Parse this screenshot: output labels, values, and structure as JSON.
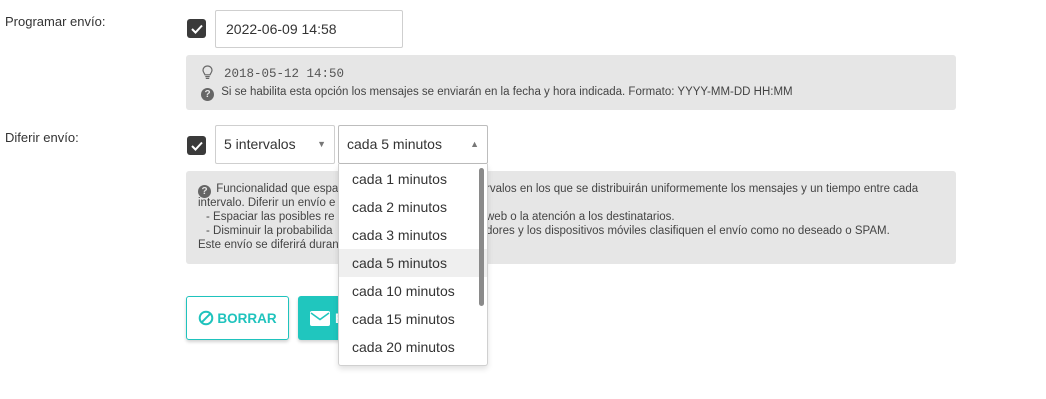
{
  "schedule": {
    "label": "Programar envío:",
    "checked": true,
    "datetime_value": "2022-06-09 14:58",
    "hint_example": "2018-05-12 14:50",
    "help_text": "Si se habilita esta opción los mensajes se enviarán en la fecha y hora indicada. Formato: YYYY-MM-DD HH:MM"
  },
  "defer": {
    "label": "Diferir envío:",
    "checked": true,
    "intervals_value": "5 intervalos",
    "interval_select_value": "cada 5 minutos",
    "help_line1_left": "Funcionalidad que espa",
    "help_line1_right": "rvalos en los que se distribuirán uniformemente los mensajes y un tiempo entre cada",
    "help_line2": "intervalo. Diferir un envío e",
    "help_line3_left": "- Espaciar las posibles re",
    "help_line3_right": "web o la atención a los destinatarios.",
    "help_line4_left": "- Disminuir la probabilida",
    "help_line4_right": "dores y los dispositivos móviles clasifiquen el envío como no deseado o SPAM.",
    "help_line5": "Este envío se diferirá duran"
  },
  "dropdown": {
    "options": [
      "cada 1 minutos",
      "cada 2 minutos",
      "cada 3 minutos",
      "cada 5 minutos",
      "cada 10 minutos",
      "cada 15 minutos",
      "cada 20 minutos"
    ],
    "selected_index": 3
  },
  "buttons": {
    "clear_label": "BORRAR",
    "send_label_visible": "E"
  },
  "colors": {
    "accent": "#20c6be",
    "checkbox": "#3a3a3a",
    "info_bg": "#e6e6e6"
  },
  "icons": {
    "checkbox": "check-icon",
    "hint": "lightbulb-icon",
    "help": "question-circle-icon",
    "clear": "ban-icon",
    "send": "envelope-icon",
    "select_open": "caret-up-icon",
    "select_closed": "caret-down-icon"
  }
}
